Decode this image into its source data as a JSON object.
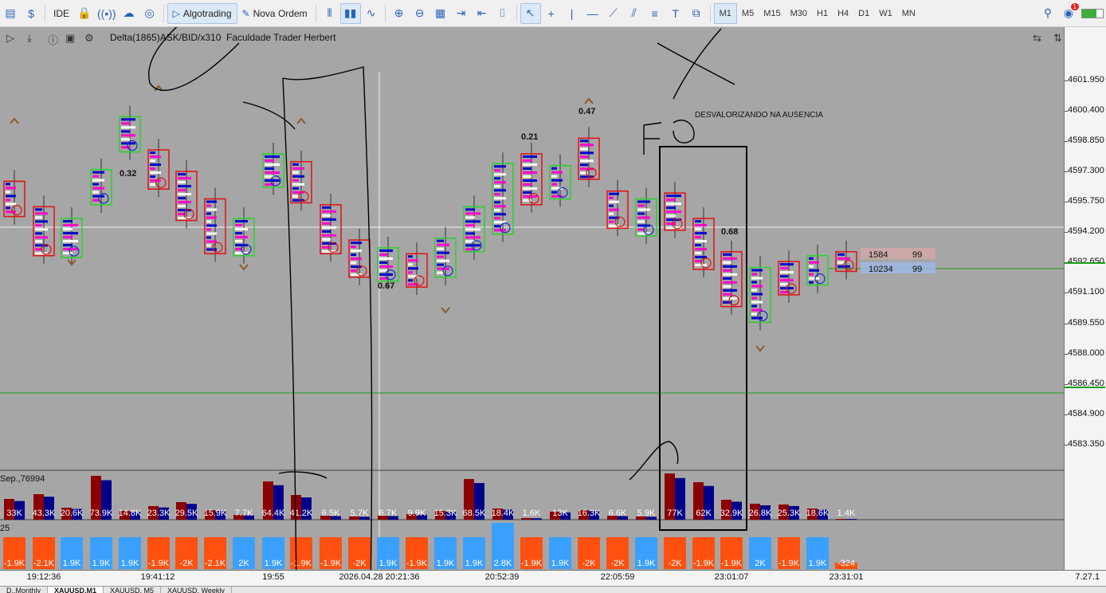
{
  "toolbar": {
    "buttons": [
      {
        "name": "chart-type-icon",
        "glyph": "▤",
        "label": ""
      },
      {
        "name": "dollar-icon",
        "glyph": "$",
        "label": ""
      },
      {
        "name": "ide-button",
        "glyph": "",
        "label": "IDE"
      },
      {
        "name": "lock-icon",
        "glyph": "🔒",
        "label": ""
      },
      {
        "name": "signal-icon",
        "glyph": "((•))",
        "label": ""
      },
      {
        "name": "cloud-icon",
        "glyph": "☁",
        "label": ""
      },
      {
        "name": "market-icon",
        "glyph": "◎",
        "label": ""
      },
      {
        "name": "algotrading-button",
        "glyph": "▷",
        "label": "Algotrading"
      },
      {
        "name": "new-order-button",
        "glyph": "✎",
        "label": "Nova Ordem"
      }
    ],
    "timeframes": [
      "M1",
      "M5",
      "M15",
      "M30",
      "H1",
      "H4",
      "D1",
      "W1",
      "MN"
    ],
    "active_timeframe": "M1",
    "notification_count": "1"
  },
  "chart_header": {
    "indicator_label": "Delta(1865)ASK/BID/x310",
    "author": "Faculdade Trader Herbert"
  },
  "chart_data": {
    "type": "bar",
    "title": "",
    "annotation": "DESVALORIZANDO NA AUSENCIA",
    "price_ticks": [
      "4601.950",
      "4600.400",
      "4598.850",
      "4597.300",
      "4595.750",
      "4594.200",
      "4592.650",
      "4591.100",
      "4589.550",
      "4588.000",
      "4586.450",
      "4584.900",
      "4583.350"
    ],
    "price_labels": {
      "current": "4592.340",
      "level": "4585.990"
    },
    "panel_label": "Sep.,76994",
    "panel2_label": "25",
    "time_labels": [
      "19:12:36",
      "19:41:12",
      "19:55",
      "2026.04.28 20:21:36",
      "20:52:39",
      "22:05:59",
      "23:01:07",
      "23:31:01"
    ],
    "time_axis_right": "7.27.1",
    "candle_values": [
      "0.32",
      "0.67",
      "0.21",
      "0.47",
      "0.68"
    ],
    "volume_labels": [
      "33K",
      "43.3K",
      "20.6K",
      "73.9K",
      "14.8K",
      "23.3K",
      "29.5K",
      "15.9K",
      "7.7K",
      "64.4K",
      "41.2K",
      "6.5K",
      "5.7K",
      "6.7K",
      "9.9K",
      "15.3K",
      "68.5K",
      "18.4K",
      "1.6K",
      "13K",
      "16.3K",
      "6.6K",
      "5.9K",
      "77K",
      "62K",
      "32.9K",
      "26.8K",
      "25.3K",
      "18.6K",
      "1.4K"
    ],
    "delta_labels": [
      "-1.9K",
      "-2.1K",
      "1.9K",
      "1.9K",
      "1.9K",
      "-1.9K",
      "-2K",
      "-2.1K",
      "2K",
      "1.9K",
      "-1.9K",
      "-1.9K",
      "-2K",
      "1.9K",
      "-1.9K",
      "1.9K",
      "1.9K",
      "2.8K",
      "-1.9K",
      "1.9K",
      "-2K",
      "-2K",
      "1.9K",
      "-2K",
      "-1.9K",
      "-1.9K",
      "2K",
      "-1.9K",
      "1.9K",
      "-324"
    ],
    "orderbook": [
      {
        "vol": "1584",
        "size": "99"
      },
      {
        "vol": "10234",
        "size": "99"
      }
    ],
    "colors": {
      "bull": "#2ad22a",
      "bear": "#e01010",
      "vol_bear": "#8b0000",
      "vol_bull": "#00008b",
      "delta_neg": "#ff5010",
      "delta_pos": "#3aa0ff",
      "price_line": "#1a9e1a"
    }
  },
  "tabs": [
    "D..Monthly",
    "XAUUSD,M1",
    "XAUUSD, M5",
    "XAUUSD, Weekly"
  ]
}
